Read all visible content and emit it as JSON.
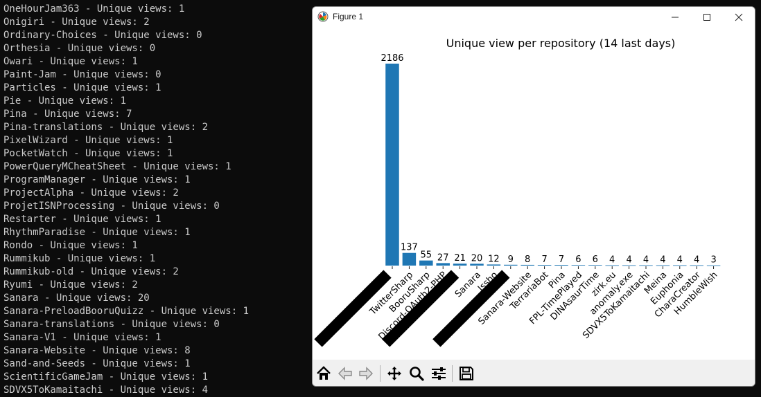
{
  "terminal": {
    "lines": [
      "OneHourJam363 - Unique views: 1",
      "Onigiri - Unique views: 2",
      "Ordinary-Choices - Unique views: 0",
      "Orthesia - Unique views: 0",
      "Owari - Unique views: 1",
      "Paint-Jam - Unique views: 0",
      "Particles - Unique views: 1",
      "Pie - Unique views: 1",
      "Pina - Unique views: 7",
      "Pina-translations - Unique views: 2",
      "PixelWizard - Unique views: 1",
      "PocketWatch - Unique views: 1",
      "PowerQueryMCheatSheet - Unique views: 1",
      "ProgramManager - Unique views: 1",
      "ProjectAlpha - Unique views: 2",
      "ProjetISNProcessing - Unique views: 0",
      "Restarter - Unique views: 1",
      "RhythmParadise - Unique views: 1",
      "Rondo - Unique views: 1",
      "Rummikub - Unique views: 1",
      "Rummikub-old - Unique views: 2",
      "Ryumi - Unique views: 2",
      "Sanara - Unique views: 20",
      "Sanara-PreloadBooruQuizz - Unique views: 1",
      "Sanara-translations - Unique views: 0",
      "Sanara-V1 - Unique views: 1",
      "Sanara-Website - Unique views: 8",
      "Sand-and-Seeds - Unique views: 1",
      "ScientificGameJam - Unique views: 1",
      "SDVX5ToKamaitachi - Unique views: 4"
    ]
  },
  "window": {
    "title": "Figure 1",
    "icons": [
      "matplotlib-icon",
      "minimize-icon",
      "maximize-icon",
      "close-icon"
    ]
  },
  "toolbar": {
    "buttons": [
      "home-icon",
      "back-icon",
      "forward-icon",
      "pan-icon",
      "zoom-icon",
      "configure-subplots-icon",
      "save-icon"
    ]
  },
  "colors": {
    "bar": "#1f77b4",
    "redaction": "#000000",
    "terminal_bg": "#0c0c0c",
    "terminal_fg": "#cccccc"
  },
  "chart_data": {
    "type": "bar",
    "title": "Unique view per repository (14 last days)",
    "categories": [
      "",
      "TwitterSharp",
      "BooruSharp",
      "Discord-OAuth2-PHP",
      "",
      "Sanara",
      "Issho",
      "",
      "Sanara-Website",
      "TerrariaBot",
      "Pina",
      "FPL-TimePlayed",
      "DINAsaurTime",
      "zirk.eu",
      "anomaly.exe",
      "SDVX5ToKamaitachi",
      "Meina",
      "Euphonia",
      "CharaCreator",
      "HumbleWish"
    ],
    "values": [
      2186,
      137,
      55,
      27,
      21,
      20,
      12,
      9,
      8,
      7,
      7,
      6,
      6,
      4,
      4,
      4,
      4,
      4,
      4,
      3
    ],
    "redacted_label_indices": [
      0,
      4,
      7
    ],
    "ylim": [
      0,
      2186
    ],
    "axes_visible": false,
    "grid": false
  }
}
